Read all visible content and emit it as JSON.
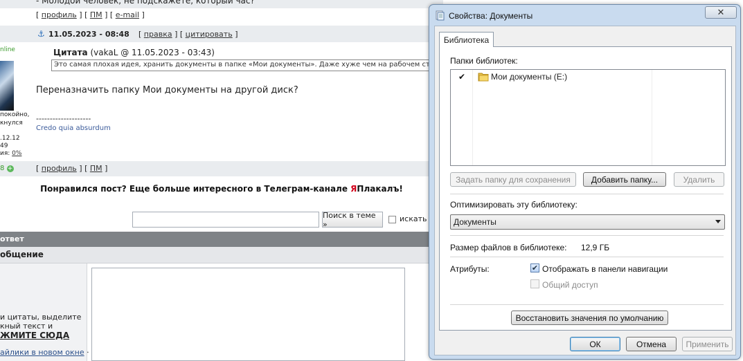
{
  "forum": {
    "question_text": "- Молодой человек, не подскажете, который час?",
    "profile_link": "профиль",
    "pm_link": "ПМ",
    "email_link": "e-mail",
    "post_date": "11.05.2023 - 08:48",
    "edit_link": "правка",
    "quote_link": "цитировать",
    "online_status": "nline",
    "quote_label": "Цитата",
    "quote_meta": "(vakaL @ 11.05.2023 - 03:43)",
    "quote_text": "Это самая плохая идея, хранить документы в папке «Мои документы». Даже хуже чем на рабочем столе",
    "post_body": "Переназначить папку Мои документы на другой диск?",
    "signature_dashes": "--------------------",
    "signature": "Credo quia absurdum",
    "side_line1": "покойно,",
    "side_line2": "кнулся",
    "side_line3": ".12.12",
    "side_line4": "49",
    "side_line5_prefix": "ия: ",
    "side_line5_value": "0%",
    "rep_value": "8",
    "telegram_prefix": "Понравился пост? Еще больше интересного в Телеграм-канале ",
    "telegram_ya": "Я",
    "telegram_suffix": "Плакалъ!",
    "search_button": "Поиск в теме »",
    "search_checkbox_label": "искать",
    "reply_bar": "ответ",
    "message_bar": "общение",
    "hint_line1": "и цитаты, выделите",
    "hint_line2": "кный текст и",
    "hint_line3": "ЖМИТЕ СЮДА",
    "hint_line4": "айлики в новом окне",
    "hint_dot": "·"
  },
  "dialog": {
    "title": "Свойства: Документы",
    "close_glyph": "✕",
    "tab_label": "Библиотека",
    "folders_label": "Папки библиотек:",
    "folders": [
      {
        "checked_mark": "✔",
        "name": "Мои документы (E:)"
      }
    ],
    "set_save_folder_btn": "Задать папку для сохранения",
    "add_folder_btn": "Добавить папку...",
    "delete_btn": "Удалить",
    "optimize_label": "Оптимизировать эту библиотеку:",
    "optimize_value": "Документы",
    "size_label": "Размер файлов в библиотеке:",
    "size_value": "12,9 ГБ",
    "attributes_label": "Атрибуты:",
    "show_nav_label": "Отображать в панели навигации",
    "show_nav_checked": true,
    "share_label": "Общий доступ",
    "share_checked": false,
    "restore_btn": "Восстановить значения по умолчанию",
    "ok_btn": "ОК",
    "cancel_btn": "Отмена",
    "apply_btn": "Применить",
    "check_glyph": "✔"
  }
}
